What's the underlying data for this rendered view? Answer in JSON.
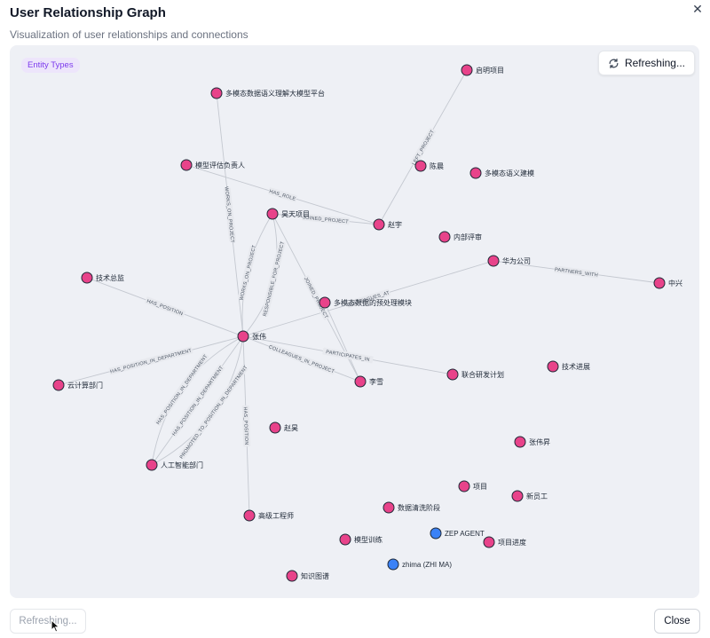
{
  "dialog": {
    "title": "User Relationship Graph",
    "subtitle": "Visualization of user relationships and connections",
    "close_icon": "close-icon"
  },
  "graph": {
    "badge": "Entity Types",
    "refresh_label": "Refreshing...",
    "colors": {
      "entity": "#e8438a",
      "agent": "#3b82f6",
      "edge": "#c4c8d0",
      "edge_label_bg": "#e7e9ee"
    },
    "nodes": [
      {
        "id": "n1",
        "label": "启明项目",
        "kind": "entity"
      },
      {
        "id": "n2",
        "label": "多模态数据语义理解大模型平台",
        "kind": "entity"
      },
      {
        "id": "n3",
        "label": "模型评估负责人",
        "kind": "entity"
      },
      {
        "id": "n4",
        "label": "陈晨",
        "kind": "entity"
      },
      {
        "id": "n5",
        "label": "多模态语义建模",
        "kind": "entity"
      },
      {
        "id": "n6",
        "label": "昊天项目",
        "kind": "entity"
      },
      {
        "id": "n7",
        "label": "赵宇",
        "kind": "entity"
      },
      {
        "id": "n8",
        "label": "内部评审",
        "kind": "entity"
      },
      {
        "id": "n9",
        "label": "华为公司",
        "kind": "entity"
      },
      {
        "id": "n10",
        "label": "技术总监",
        "kind": "entity"
      },
      {
        "id": "n11",
        "label": "中兴",
        "kind": "entity"
      },
      {
        "id": "n12",
        "label": "多模态数据的预处理模块",
        "kind": "entity"
      },
      {
        "id": "n13",
        "label": "张伟",
        "kind": "entity"
      },
      {
        "id": "n14",
        "label": "云计算部门",
        "kind": "entity"
      },
      {
        "id": "n15",
        "label": "技术进展",
        "kind": "entity"
      },
      {
        "id": "n16",
        "label": "联合研发计划",
        "kind": "entity"
      },
      {
        "id": "n17",
        "label": "李雪",
        "kind": "entity"
      },
      {
        "id": "n18",
        "label": "赵昊",
        "kind": "entity"
      },
      {
        "id": "n19",
        "label": "张伟昇",
        "kind": "entity"
      },
      {
        "id": "n20",
        "label": "人工智能部门",
        "kind": "entity"
      },
      {
        "id": "n21",
        "label": "项目",
        "kind": "entity"
      },
      {
        "id": "n22",
        "label": "新员工",
        "kind": "entity"
      },
      {
        "id": "n23",
        "label": "数据清洗阶段",
        "kind": "entity"
      },
      {
        "id": "n24",
        "label": "高级工程师",
        "kind": "entity"
      },
      {
        "id": "n25",
        "label": "ZEP AGENT",
        "kind": "agent"
      },
      {
        "id": "n26",
        "label": "模型训练",
        "kind": "entity"
      },
      {
        "id": "n27",
        "label": "项目进度",
        "kind": "entity"
      },
      {
        "id": "n28",
        "label": "zhima (ZHI MA)",
        "kind": "agent"
      },
      {
        "id": "n29",
        "label": "知识图谱",
        "kind": "entity"
      }
    ],
    "edges": [
      {
        "from": "n7",
        "to": "n1",
        "label": "LEFT_PROJECT"
      },
      {
        "from": "n3",
        "to": "n7",
        "label": "HAS_ROLE"
      },
      {
        "from": "n6",
        "to": "n7",
        "label": "JOINED_PROJECT"
      },
      {
        "from": "n2",
        "to": "n13",
        "label": "WORKS_ON_PROJECT"
      },
      {
        "from": "n6",
        "to": "n13",
        "label": "RESPONSIBLE_FOR_PROJECT"
      },
      {
        "from": "n6",
        "to": "n13",
        "label": "WORKS_ON_PROJECT"
      },
      {
        "from": "n6",
        "to": "n17",
        "label": "JOINED_PROJECT"
      },
      {
        "from": "n13",
        "to": "n9",
        "label": "COLLEAGUES_AT"
      },
      {
        "from": "n9",
        "to": "n11",
        "label": "PARTNERS_WITH"
      },
      {
        "from": "n10",
        "to": "n13",
        "label": "HAS_POSITION"
      },
      {
        "from": "n13",
        "to": "n14",
        "label": "HAS_POSITION_IN_DEPARTMENT"
      },
      {
        "from": "n13",
        "to": "n16",
        "label": "PARTICIPATES_IN"
      },
      {
        "from": "n13",
        "to": "n17",
        "label": "COLLEAGUES_IN_PROJECT"
      },
      {
        "from": "n13",
        "to": "n20",
        "label": "PROMOTED_TO_POSITION_IN_DEPARTMENT"
      },
      {
        "from": "n13",
        "to": "n20",
        "label": "HAS_POSITION_IN_DEPARTMENT"
      },
      {
        "from": "n13",
        "to": "n20",
        "label": "HAS_POSITION_IN_DEPARTMENT"
      },
      {
        "from": "n13",
        "to": "n24",
        "label": "HAS_POSITION"
      },
      {
        "from": "n12",
        "to": "n17",
        "label": ""
      }
    ]
  },
  "footer": {
    "refresh_label": "Refreshing...",
    "close_label": "Close"
  }
}
